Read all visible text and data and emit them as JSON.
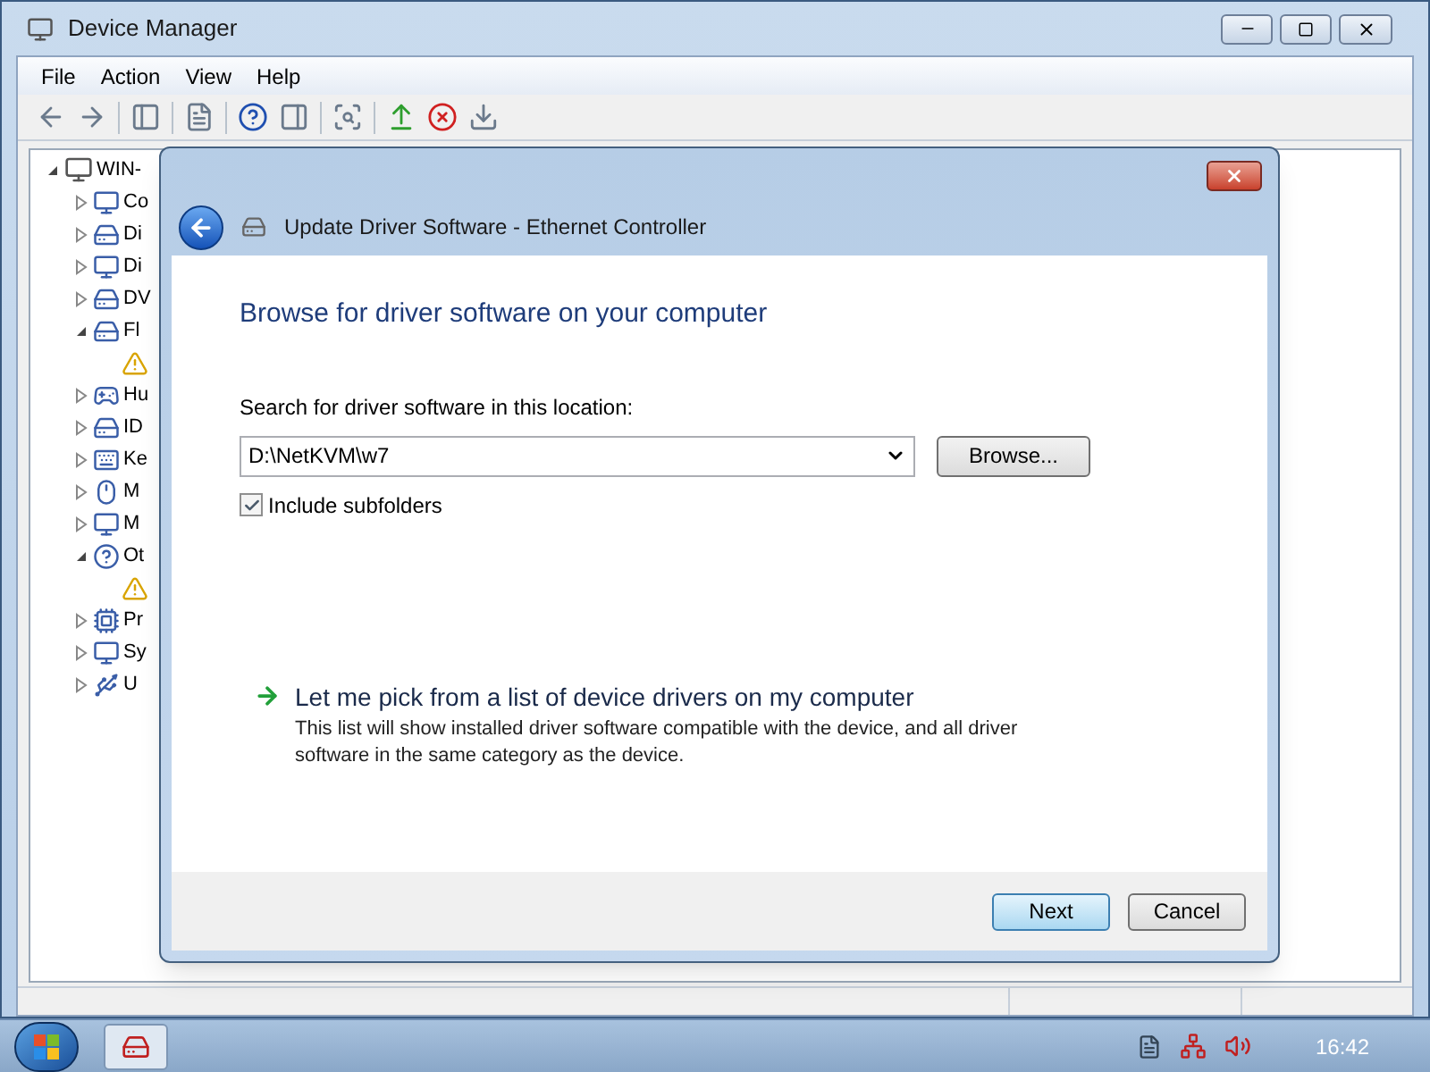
{
  "window": {
    "title": "Device Manager",
    "menu": [
      "File",
      "Action",
      "View",
      "Help"
    ]
  },
  "tree": {
    "label": "WIN-",
    "expanded": true,
    "children": [
      {
        "label": "Co",
        "expanded": false,
        "kind": "computer"
      },
      {
        "label": "Di",
        "expanded": false,
        "kind": "drive"
      },
      {
        "label": "Di",
        "expanded": false,
        "kind": "display"
      },
      {
        "label": "DV",
        "expanded": false,
        "kind": "drive"
      },
      {
        "label": "Fl",
        "expanded": true,
        "kind": "drive",
        "children": [
          {
            "kind": "warning"
          }
        ]
      },
      {
        "label": "Hu",
        "expanded": false,
        "kind": "hid"
      },
      {
        "label": "ID",
        "expanded": false,
        "kind": "drive"
      },
      {
        "label": "Ke",
        "expanded": false,
        "kind": "keyboard"
      },
      {
        "label": "M",
        "expanded": false,
        "kind": "mouse"
      },
      {
        "label": "M",
        "expanded": false,
        "kind": "display"
      },
      {
        "label": "Ot",
        "expanded": true,
        "kind": "unknown",
        "children": [
          {
            "kind": "warning"
          }
        ]
      },
      {
        "label": "Pr",
        "expanded": false,
        "kind": "chip"
      },
      {
        "label": "Sy",
        "expanded": false,
        "kind": "computer"
      },
      {
        "label": "U",
        "expanded": false,
        "kind": "usb"
      }
    ]
  },
  "dialog": {
    "title": "Update Driver Software - Ethernet Controller",
    "heading": "Browse for driver software on your computer",
    "location_label": "Search for driver software in this location:",
    "location_value": "D:\\NetKVM\\w7",
    "browse_button": "Browse...",
    "include_subfolders": {
      "label": "Include subfolders",
      "checked": true
    },
    "pick_option": {
      "title": "Let me pick from a list of device drivers on my computer",
      "description": "This list will show installed driver software compatible with the device, and all driver software in the same category as the device."
    },
    "buttons": [
      {
        "label": "Next",
        "default": true
      },
      {
        "label": "Cancel",
        "default": false
      }
    ]
  },
  "taskbar": {
    "clock": "16:42"
  }
}
